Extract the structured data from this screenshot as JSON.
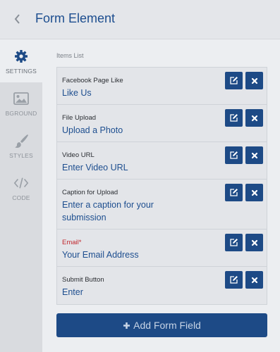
{
  "header": {
    "title": "Form Element",
    "back_icon": "chevron-left-icon"
  },
  "sidebar": {
    "items": [
      {
        "label": "SETTINGS",
        "icon": "gear-icon",
        "active": true
      },
      {
        "label": "BGROUND",
        "icon": "image-icon",
        "active": false
      },
      {
        "label": "STYLES",
        "icon": "paintbrush-icon",
        "active": false
      },
      {
        "label": "CODE",
        "icon": "code-icon",
        "active": false
      }
    ]
  },
  "main": {
    "items_caption": "Items List",
    "items": [
      {
        "label": "Facebook Page Like",
        "value": "Like Us",
        "required": false
      },
      {
        "label": "File Upload",
        "value": "Upload a Photo",
        "required": false
      },
      {
        "label": "Video URL",
        "value": "Enter Video URL",
        "required": false
      },
      {
        "label": "Caption for Upload",
        "value": "Enter a caption for your submission",
        "required": false
      },
      {
        "label": "Email",
        "required_mark": "*",
        "value": "Your Email Address",
        "required": true
      },
      {
        "label": "Submit Button",
        "value": "Enter",
        "required": false
      }
    ],
    "add_button_label": "Add Form Field"
  },
  "colors": {
    "accent": "#1d4a86",
    "title_text": "#1d4e8f",
    "required": "#c0262d"
  }
}
